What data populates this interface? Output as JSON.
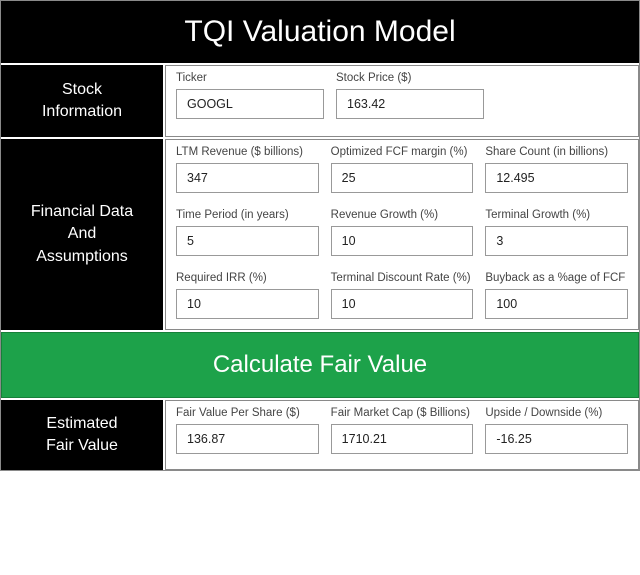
{
  "title": "TQI Valuation Model",
  "sections": {
    "stock": {
      "label_lines": [
        "Stock",
        "Information"
      ],
      "fields": [
        {
          "label": "Ticker",
          "value": "GOOGL"
        },
        {
          "label": "Stock Price ($)",
          "value": "163.42"
        }
      ]
    },
    "financial": {
      "label_lines": [
        "Financial Data",
        "And",
        "Assumptions"
      ],
      "rows": [
        [
          {
            "label": "LTM Revenue ($ billions)",
            "value": "347"
          },
          {
            "label": "Optimized FCF margin (%)",
            "value": "25"
          },
          {
            "label": "Share Count (in billions)",
            "value": "12.495"
          }
        ],
        [
          {
            "label": "Time Period (in years)",
            "value": "5"
          },
          {
            "label": "Revenue Growth (%)",
            "value": "10"
          },
          {
            "label": "Terminal Growth (%)",
            "value": "3"
          }
        ],
        [
          {
            "label": "Required IRR (%)",
            "value": "10"
          },
          {
            "label": "Terminal Discount Rate (%)",
            "value": "10"
          },
          {
            "label": "Buyback as a %age of FCF",
            "value": "100"
          }
        ]
      ]
    },
    "calculate_label": "Calculate Fair Value",
    "estimated": {
      "label_lines": [
        "Estimated",
        "Fair Value"
      ],
      "fields": [
        {
          "label": "Fair Value Per Share ($)",
          "value": "136.87"
        },
        {
          "label": "Fair Market Cap ($ Billions)",
          "value": "1710.21"
        },
        {
          "label": "Upside / Downside (%)",
          "value": "-16.25"
        }
      ]
    }
  }
}
